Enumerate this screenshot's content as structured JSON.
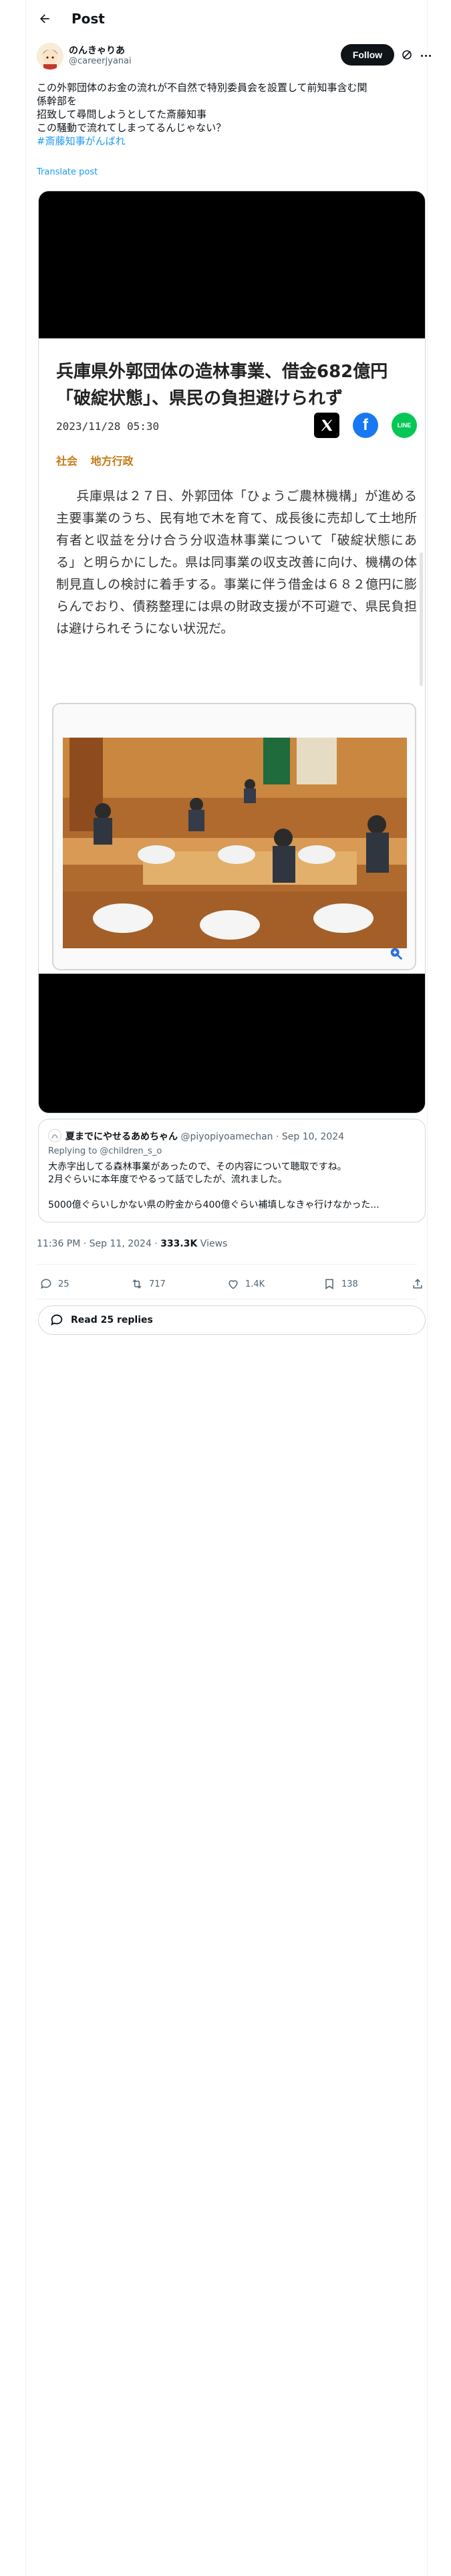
{
  "header": {
    "title": "Post"
  },
  "author": {
    "name": "のんきゃりあ",
    "handle": "@careerjyanai",
    "follow_label": "Follow"
  },
  "post": {
    "lines": [
      "この外郭団体のお金の流れが不自然で特別委員会を設置して前知事含む関",
      "係幹部を",
      "招致して尋問しようとしてた斎藤知事",
      "この騒動で流れてしまってるんじゃない？"
    ],
    "hashtag": "#斎藤知事がんばれ",
    "translate": "Translate post"
  },
  "article": {
    "title": "兵庫県外郭団体の造林事業、借金682億円「破綻状態」、県民の負担避けられず",
    "date": "2023/11/28 05:30",
    "tags": [
      "社会",
      "地方行政"
    ],
    "share": {
      "x": "X",
      "facebook": "f",
      "line": "LINE"
    },
    "body": "兵庫県は２７日、外郭団体「ひょうご農林機構」が進める主要事業のうち、民有地で木を育て、成長後に売却して土地所有者と収益を分け合う分収造林事業について「破綻状態にある」と明らかにした。県は同事業の収支改善に向け、機構の体制見直しの検討に着手する。事業に伴う借金は６８２億円に膨らんでおり、債務整理には県の財政支援が不可避で、県民負担は避けられそうにない状況だ。"
  },
  "quote": {
    "name": "夏までにやせるあめちゃん",
    "handle": "@piyopiyoamechan",
    "date": "Sep 10, 2024",
    "reply_to": "Replying to @children_s_o",
    "lines": [
      "大赤字出してる森林事業があったので、その内容について聴取ですね。",
      "2月ぐらいに本年度でやるって話でしたが、流れました。",
      "",
      "5000億ぐらいしかない県の貯金から400億ぐらい補填しなきゃ行けなかった..."
    ]
  },
  "meta": {
    "time": "11:36 PM · Sep 11, 2024 · ",
    "views_count": "333.3K",
    "views_label": " Views"
  },
  "actions": {
    "replies": "25",
    "reposts": "717",
    "likes": "1.4K",
    "bookmarks": "138"
  },
  "read_replies": "Read 25 replies",
  "colors": {
    "accent": "#1d9bf0",
    "text": "#0f1419",
    "muted": "#536471",
    "tag": "#c67a16"
  }
}
